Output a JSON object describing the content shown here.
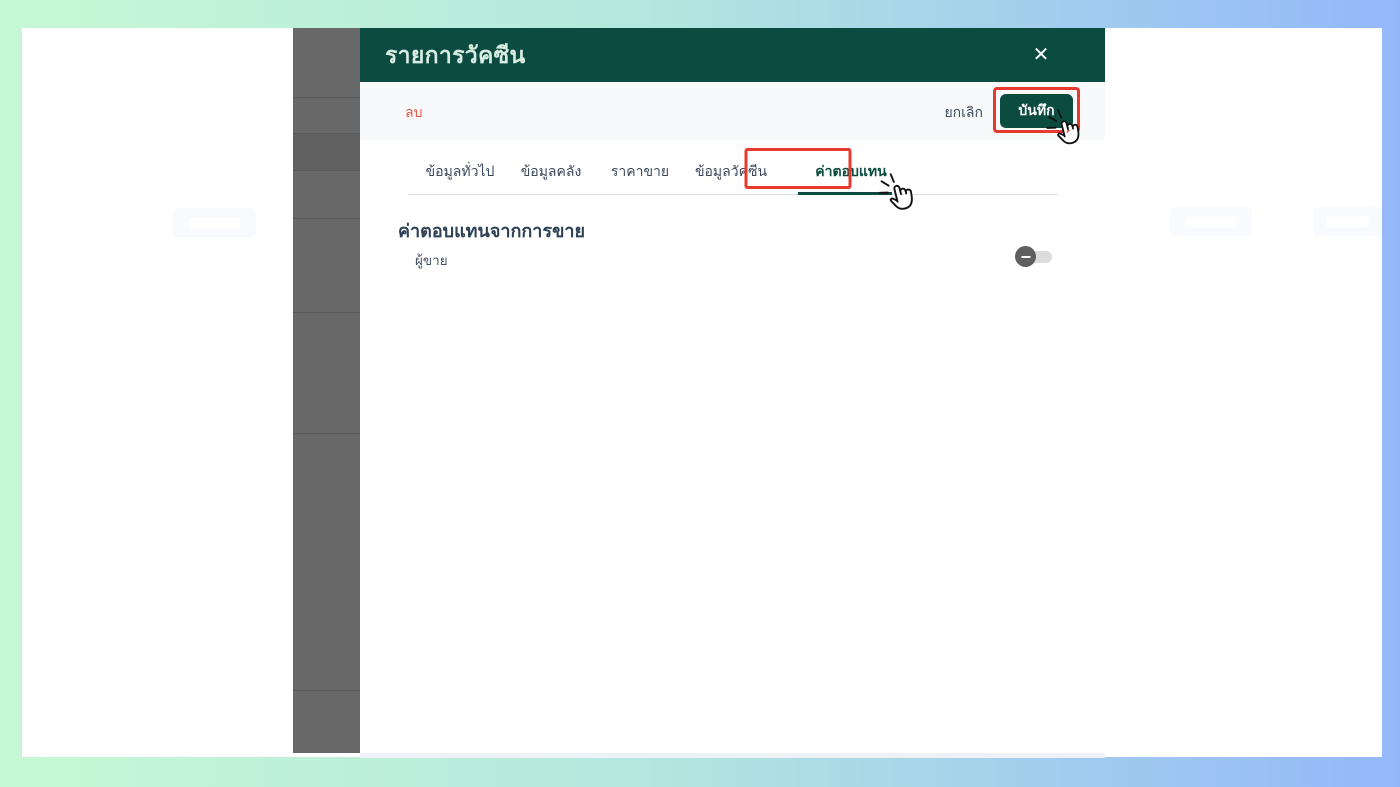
{
  "modal": {
    "title": "รายการวัคซีน",
    "close_glyph": "✕",
    "toolbar": {
      "delete": "ลบ",
      "cancel": "ยกเลิก",
      "save": "บันทึก"
    },
    "tabs": [
      {
        "label": "ข้อมูลทั่วไป",
        "active": false
      },
      {
        "label": "ข้อมูลคลัง",
        "active": false
      },
      {
        "label": "ราคาขาย",
        "active": false
      },
      {
        "label": "ข้อมูลวัคซีน",
        "active": false
      },
      {
        "label": "ค่าตอบแทน",
        "active": true
      }
    ],
    "content": {
      "section_title": "ค่าตอบแทนจากการขาย",
      "rows": [
        {
          "label": "ผู้ขาย",
          "control": "toggle",
          "state": "off"
        }
      ]
    }
  },
  "colors": {
    "header_green": "#0c4b3f",
    "active_tab_green": "#0b4a3e",
    "delete_red": "#e4564a",
    "annotation_red": "#e8392e",
    "sidebar_gray": "#686868"
  },
  "annotations": [
    {
      "type": "click-highlight",
      "target": "save-button"
    },
    {
      "type": "click-highlight",
      "target": "tab-compensation"
    }
  ]
}
